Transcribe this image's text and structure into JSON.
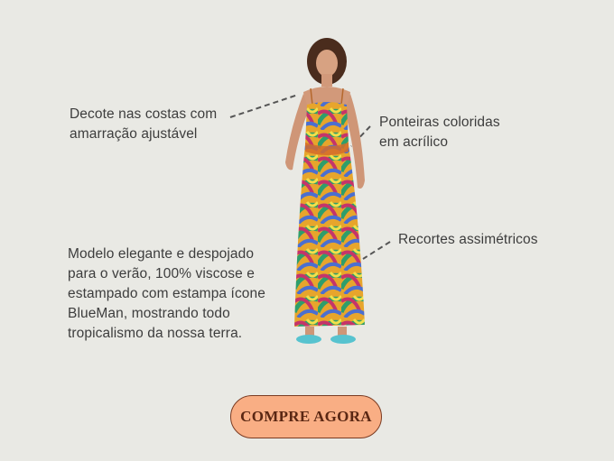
{
  "annotations": {
    "decote": "Decote nas costas com\namarração ajustável",
    "ponteiras": "Ponteiras coloridas\nem acrílico",
    "recortes": "Recortes assimétricos",
    "descricao": "Modelo elegante e despojado\npara o verão, 100% viscose e\nestampado com estampa ícone\nBlueMan, mostrando todo\ntropicalismo da nossa terra."
  },
  "cta": {
    "label": "COMPRE AGORA"
  },
  "colors": {
    "background": "#e9e9e4",
    "cta_fill": "#f9ae84",
    "cta_border": "#7a3b22",
    "text": "#3d3d3d"
  }
}
